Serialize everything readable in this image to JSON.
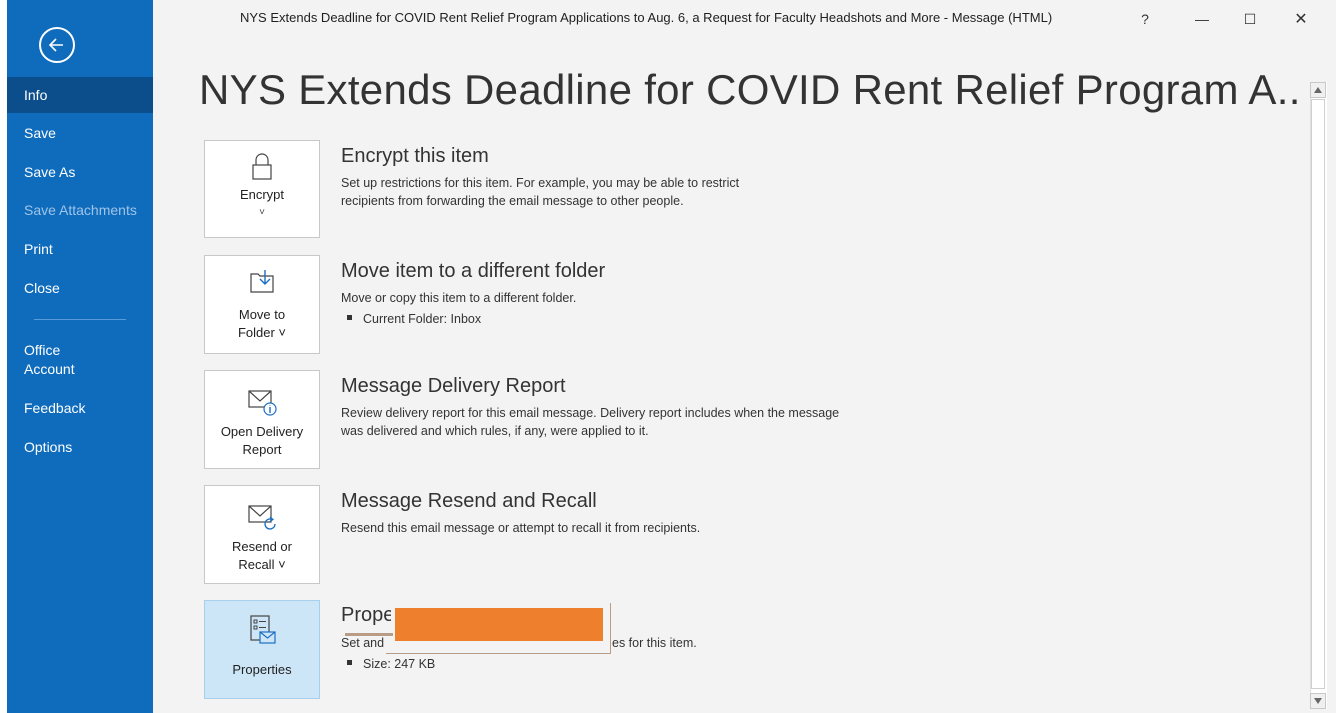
{
  "window": {
    "title": "NYS Extends Deadline for COVID Rent Relief Program Applications to Aug. 6, a Request for Faculty Headshots and More  -  Message (HTML)",
    "help_label": "?",
    "minimize_label": "—",
    "maximize_label": "☐",
    "close_label": "✕"
  },
  "sidebar": {
    "items": [
      {
        "label": "Info"
      },
      {
        "label": "Save"
      },
      {
        "label": "Save As"
      },
      {
        "label": "Save Attachments"
      },
      {
        "label": "Print"
      },
      {
        "label": "Close"
      },
      {
        "label": "Office Account"
      },
      {
        "label": "Feedback"
      },
      {
        "label": "Options"
      }
    ]
  },
  "main": {
    "title": "NYS Extends Deadline for COVID Rent Relief Program A...",
    "sections": [
      {
        "button_label": "Encrypt",
        "heading": "Encrypt this item",
        "description": "Set up restrictions for this item. For example, you may be able to restrict recipients from forwarding the email message to other people."
      },
      {
        "button_label_1": "Move to",
        "button_label_2": "Folder ˅",
        "heading": "Move item to a different folder",
        "description": "Move or copy this item to a different folder.",
        "bullet": "Current Folder:   Inbox"
      },
      {
        "button_label_1": "Open Delivery",
        "button_label_2": "Report",
        "heading": "Message Delivery Report",
        "description": "Review delivery report for this email message. Delivery report includes when the message was delivered and which rules, if any, were applied to it."
      },
      {
        "button_label_1": "Resend or",
        "button_label_2": "Recall ˅",
        "heading": "Message Resend and Recall",
        "description": "Resend this email message or attempt to recall it from recipients."
      },
      {
        "button_label": "Properties",
        "heading": "Prope",
        "description_start": "Set and",
        "description_end": "es for this item.",
        "bullet": "Size:   247 KB"
      }
    ]
  },
  "colors": {
    "sidebar": "#0f6cbd",
    "sidebar_active": "#0b4e8b",
    "redaction": "#ee7f2d",
    "selected_button": "#cde6f7"
  }
}
